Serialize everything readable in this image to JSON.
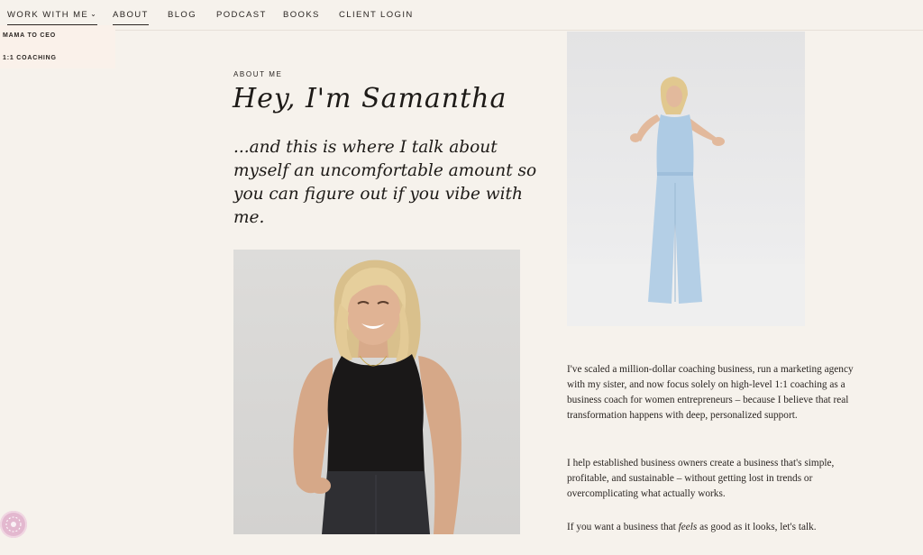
{
  "nav": {
    "items": [
      {
        "label": "WORK WITH ME",
        "has_dropdown": true
      },
      {
        "label": "ABOUT",
        "active": true
      },
      {
        "label": "BLOG"
      },
      {
        "label": "PODCAST"
      },
      {
        "label": "BOOKS"
      },
      {
        "label": "CLIENT LOGIN"
      }
    ],
    "dropdown": {
      "items": [
        "MAMA TO CEO",
        "1:1 COACHING"
      ]
    }
  },
  "hero": {
    "eyebrow": "ABOUT ME",
    "title": "Hey, I'm Samantha",
    "subhead": "...and this is where I talk about myself an uncomfortable amount so you can figure out if you vibe with me."
  },
  "about": {
    "paragraph_1": "I've scaled a million-dollar coaching business, run a marketing agency with my sister, and now focus solely on high-level 1:1 coaching as a business coach for women entrepreneurs – because I believe that real transformation happens with deep, personalized support.",
    "paragraph_2": "I help established business owners create a business that's simple, profitable, and sustainable – without getting lost in trends or overcomplicating what actually works.",
    "paragraph_3_before": "If you want a business that ",
    "paragraph_3_em": "feels",
    "paragraph_3_after": " as good as it looks, let's talk."
  },
  "colors": {
    "background": "#f6f2ec",
    "text": "#1d1a17",
    "dropdown_bg": "#faf1ea",
    "badge": "#e3b8cf"
  }
}
